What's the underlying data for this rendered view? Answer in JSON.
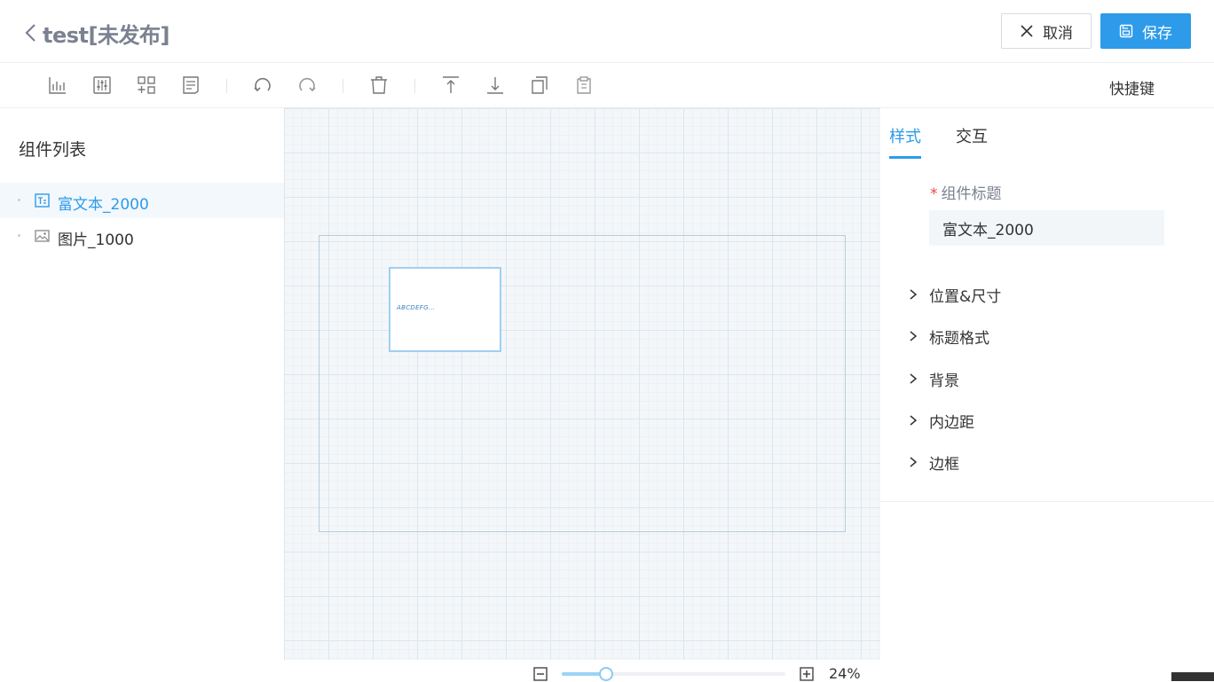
{
  "header": {
    "title": "test[未发布]",
    "cancel_label": "取消",
    "save_label": "保存"
  },
  "toolbar": {
    "icons": [
      "chart-icon",
      "filter-icon",
      "add-component-icon",
      "report-icon",
      "undo-icon",
      "redo-icon",
      "delete-icon",
      "bring-to-top-icon",
      "send-to-bottom-icon",
      "copy-icon",
      "paste-icon"
    ],
    "shortcut_label": "快捷键"
  },
  "sidebar": {
    "title": "组件列表",
    "items": [
      {
        "label": "富文本_2000",
        "icon": "rich-text-icon",
        "active": true
      },
      {
        "label": "图片_1000",
        "icon": "image-icon",
        "active": false
      }
    ]
  },
  "canvas": {
    "widget_text": "ABCDEFG..."
  },
  "zoom": {
    "value_label": "24%",
    "level": 0.2
  },
  "panel": {
    "tabs": [
      {
        "label": "样式",
        "active": true
      },
      {
        "label": "交互",
        "active": false
      }
    ],
    "title_label": "组件标题",
    "title_value": "富文本_2000",
    "sections": [
      "位置&尺寸",
      "标题格式",
      "背景",
      "内边距",
      "边框"
    ]
  },
  "colors": {
    "accent": "#2d9bea",
    "required": "#ee4444"
  }
}
